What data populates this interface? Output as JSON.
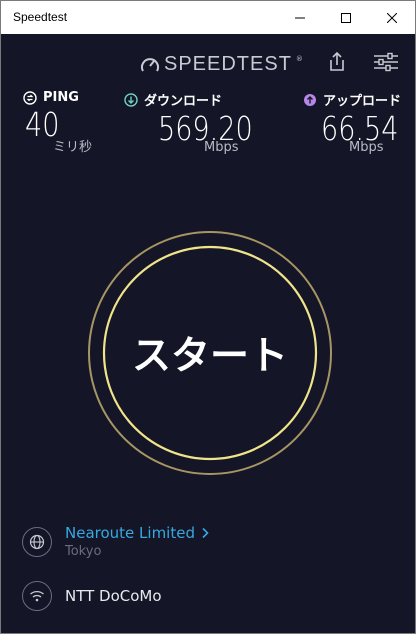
{
  "window": {
    "title": "Speedtest"
  },
  "header": {
    "logo_text": "SPEEDTEST",
    "logo_tm": "®"
  },
  "metrics": {
    "ping": {
      "label": "PING",
      "value": "40",
      "unit": "ミリ秒"
    },
    "download": {
      "label": "ダウンロード",
      "value": "569.20",
      "unit": "Mbps"
    },
    "upload": {
      "label": "アップロード",
      "value": "66.54",
      "unit": "Mbps"
    }
  },
  "start": {
    "label": "スタート"
  },
  "server": {
    "name": "Nearoute Limited",
    "location": "Tokyo"
  },
  "isp": {
    "name": "NTT DoCoMo"
  },
  "colors": {
    "background": "#141526",
    "ring_outer": "#b7a36a",
    "ring_inner": "#efe48a",
    "download_icon": "#6fd2c6",
    "upload_icon": "#b687e6",
    "link": "#36a8e0"
  },
  "icons": {
    "ping": "ping-icon",
    "download": "download-arrow-icon",
    "upload": "upload-arrow-icon",
    "share": "share-icon",
    "settings": "settings-sliders-icon",
    "server": "globe-icon",
    "isp": "wifi-icon"
  }
}
